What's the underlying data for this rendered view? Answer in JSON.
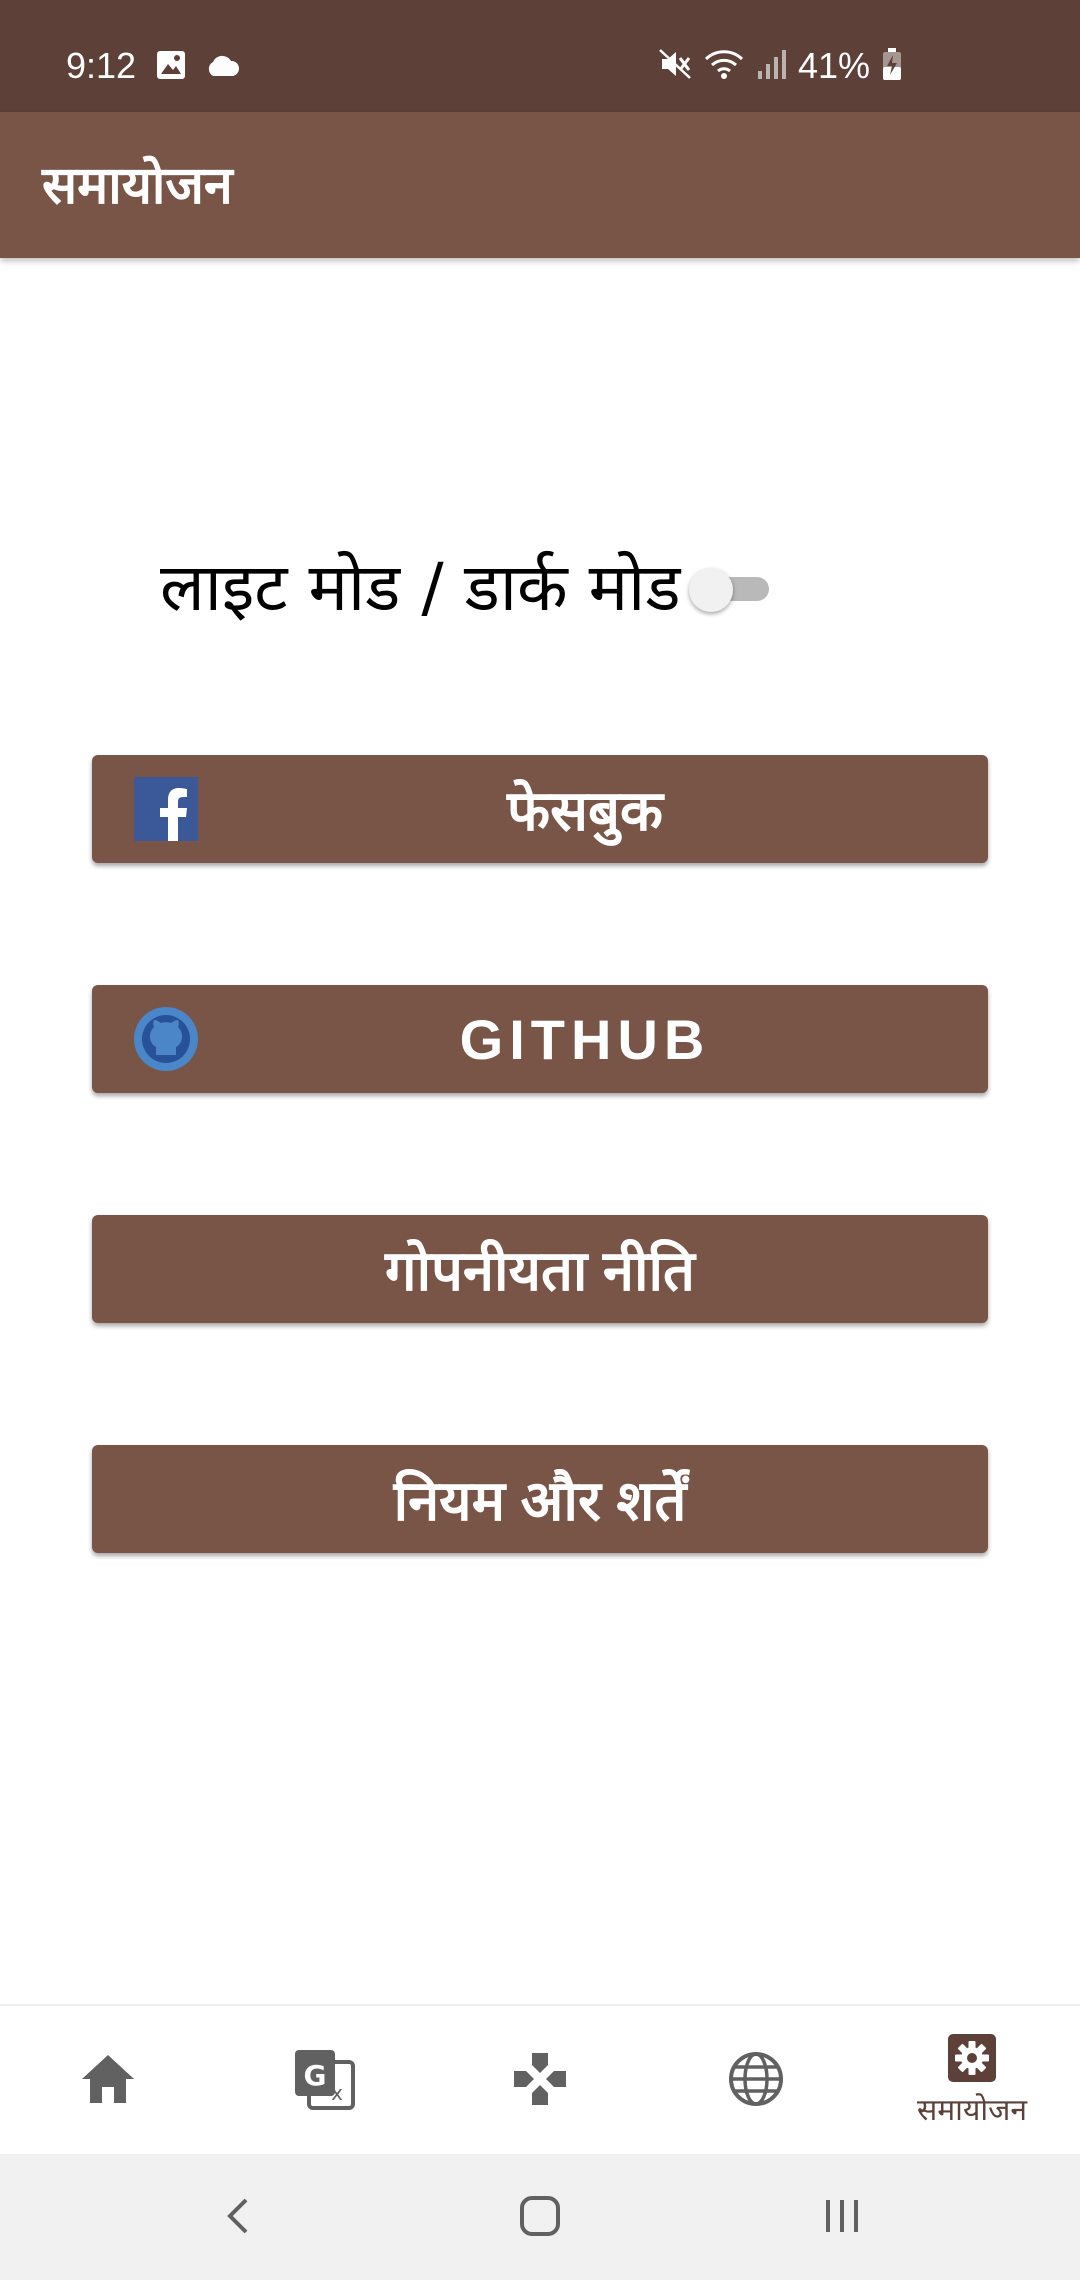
{
  "status_bar": {
    "time": "9:12",
    "battery": "41%",
    "left_icons": [
      "image-icon",
      "cloud-icon"
    ],
    "right_icons": [
      "mute-icon",
      "wifi-icon",
      "signal-icon",
      "battery-charging-icon"
    ]
  },
  "app_bar": {
    "title": "समायोजन"
  },
  "settings": {
    "mode_label": "लाइट मोड / डार्क मोड",
    "dark_mode_enabled": false
  },
  "buttons": {
    "facebook": "फेसबुक",
    "github": "GITHUB",
    "privacy": "गोपनीयता नीति",
    "terms": "नियम और शर्तें"
  },
  "bottom_nav": {
    "items": [
      {
        "icon": "home-icon",
        "label": ""
      },
      {
        "icon": "translate-icon",
        "label": ""
      },
      {
        "icon": "game-icon",
        "label": ""
      },
      {
        "icon": "globe-icon",
        "label": ""
      },
      {
        "icon": "settings-icon",
        "label": "समायोजन",
        "active": true
      }
    ]
  },
  "colors": {
    "status_bar": "#5d4037",
    "app_bar": "#795548",
    "button": "#795548",
    "nav_icon": "#616161",
    "nav_active": "#5d4037"
  }
}
